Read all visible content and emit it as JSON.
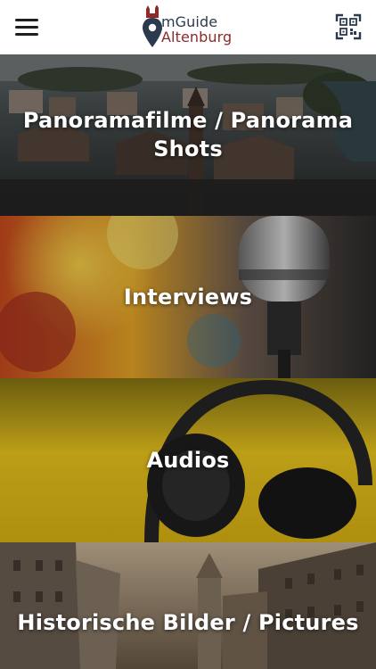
{
  "header": {
    "menu_icon": "hamburger-menu-icon",
    "logo": {
      "line1": "mGuide",
      "line2": "Altenburg",
      "line1_color": "#2b3b4d",
      "line2_color": "#8b2b2b",
      "icon": "map-pin-castle-icon"
    },
    "qr_icon": "qr-code-scan-icon"
  },
  "tiles": [
    {
      "label": "Panoramafilme / Panorama Shots",
      "image": "aerial-town-view"
    },
    {
      "label": "Interviews",
      "image": "studio-microphone"
    },
    {
      "label": "Audios",
      "image": "headphones-on-yellow"
    },
    {
      "label": "Historische Bilder / Pictures",
      "image": "historic-street-sepia"
    }
  ]
}
